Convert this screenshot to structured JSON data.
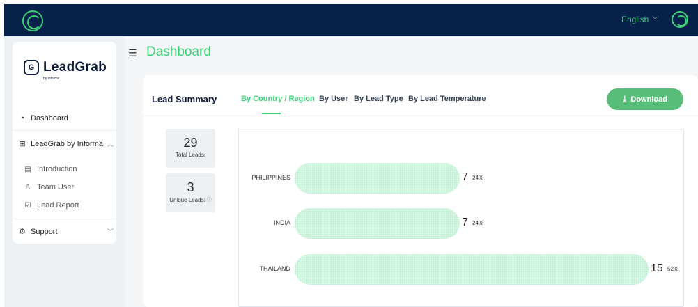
{
  "header": {
    "language": "English",
    "language_chevron": "﹀"
  },
  "sidebar": {
    "brand_name": "LeadGrab",
    "brand_mark": "G",
    "brand_sub": "by informa",
    "items": [
      {
        "label": "Dashboard",
        "icon": "dashboard-icon"
      },
      {
        "label": "LeadGrab by Informa",
        "icon": "sitemap-icon",
        "expanded": true
      },
      {
        "label": "Support",
        "icon": "support-icon",
        "expanded": false
      }
    ],
    "sub_items": [
      {
        "label": "Introduction",
        "icon": "document-icon"
      },
      {
        "label": "Team User",
        "icon": "user-icon"
      },
      {
        "label": "Lead Report",
        "icon": "report-icon"
      }
    ]
  },
  "page": {
    "title": "Dashboard"
  },
  "card": {
    "title": "Lead Summary",
    "tabs": [
      {
        "label": "By Country / Region",
        "active": true
      },
      {
        "label": "By User",
        "active": false
      },
      {
        "label": "By Lead Type",
        "active": false
      },
      {
        "label": "By Lead Temperature",
        "active": false
      }
    ],
    "download_label": "Download"
  },
  "stats": {
    "total_value": "29",
    "total_label": "Total Leads:",
    "unique_value": "3",
    "unique_label": "Unique Leads:"
  },
  "colors": {
    "accent": "#3ccf78",
    "topbar": "#06214a",
    "button": "#59bd7a",
    "bar_fill": "#d9f7e6"
  },
  "chart_data": {
    "type": "bar",
    "orientation": "horizontal",
    "categories": [
      "PHILIPPINES",
      "INDIA",
      "THAILAND"
    ],
    "values": [
      7,
      7,
      15
    ],
    "percent_labels": [
      "24%",
      "24%",
      "52%"
    ],
    "xlim": [
      0,
      15
    ],
    "grid": false
  }
}
